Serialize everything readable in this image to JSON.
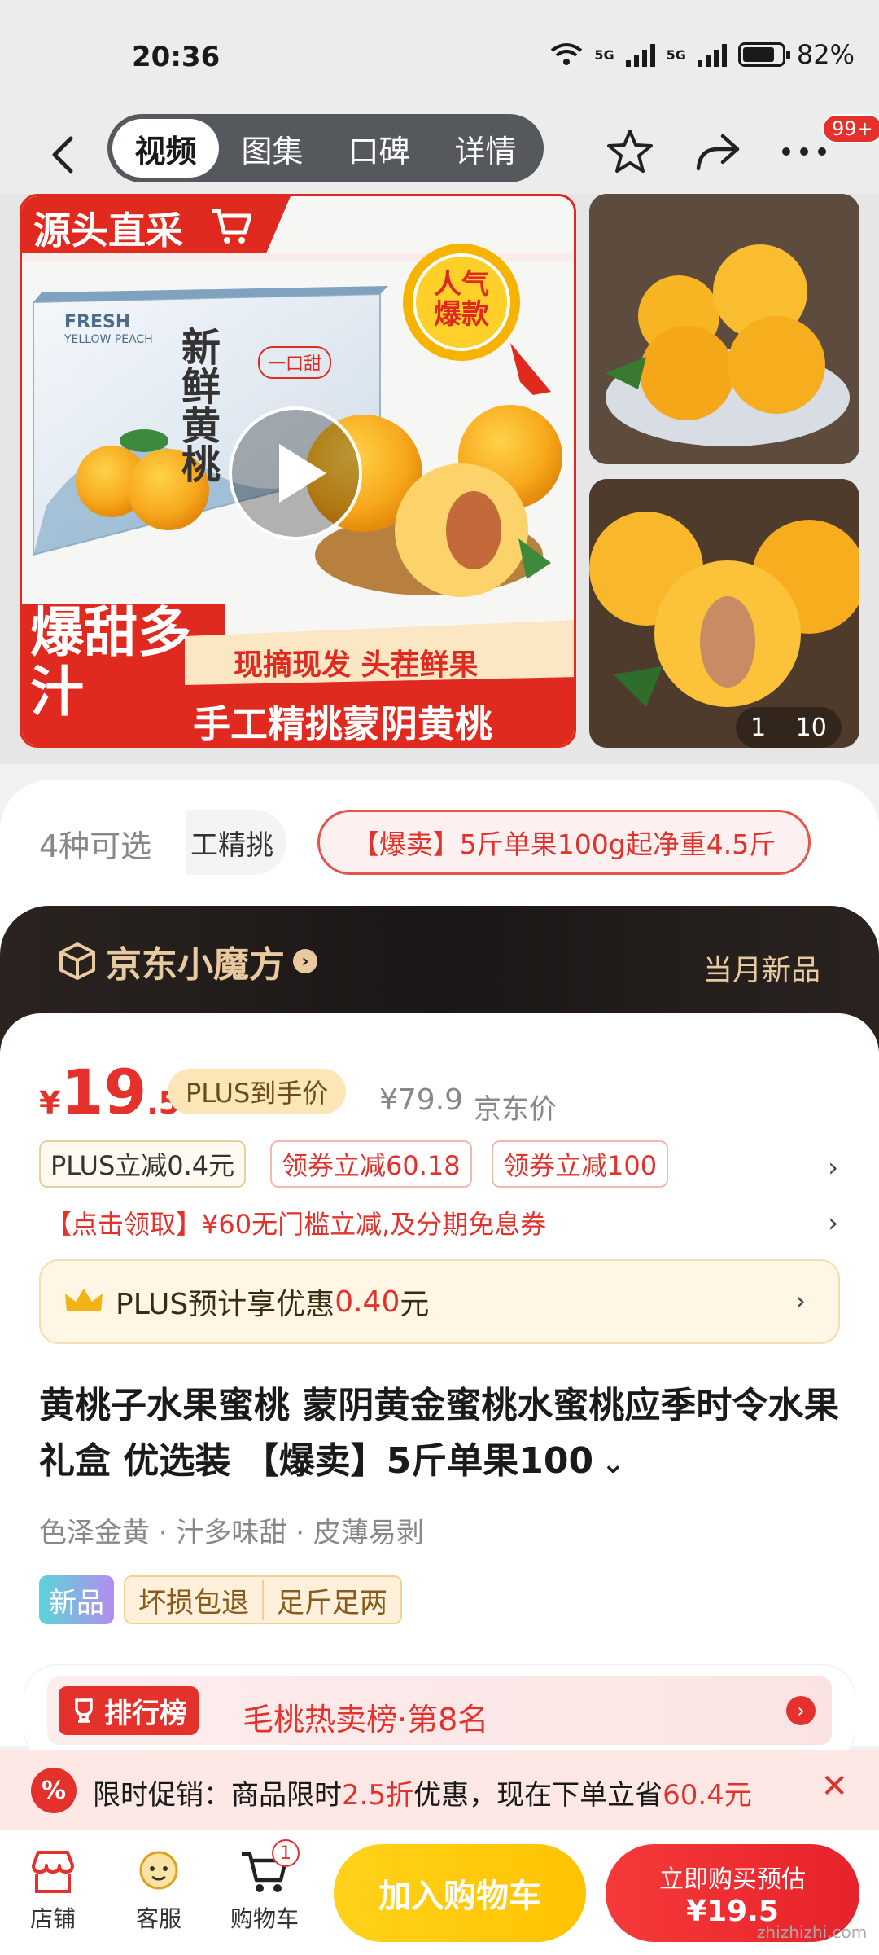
{
  "status": {
    "time": "20:36",
    "battery": "82%",
    "net1": "5G",
    "net2": "5G"
  },
  "nav": {
    "tabs": [
      "视频",
      "图集",
      "口碑",
      "详情"
    ],
    "active_tab": 0,
    "badge": "99+"
  },
  "gallery": {
    "main_banner_top": "源头直采",
    "box_fresh": "FRESH",
    "box_sub": "YELLOW PEACH",
    "box_cn": "新鲜黄桃",
    "box_tag": "一口甜",
    "badge_text": "人气爆款",
    "slogan_left": "爆甜多汁",
    "slogan_top": "现摘现发 头茬鲜果",
    "slogan_bottom": "手工精挑蒙阴黄桃",
    "counter_current": "1",
    "counter_total": "10"
  },
  "variants": {
    "count_label": "4种可选",
    "chip1": "工精挑",
    "chip2": "【爆卖】5斤单果100g起净重4.5斤"
  },
  "cube": {
    "title": "京东小魔方",
    "right_label": "当月新品"
  },
  "price": {
    "symbol": "¥",
    "integer": "19",
    "decimal": ".5",
    "plus_label": "PLUS到手价",
    "original": "¥79.9",
    "original_label": "京东价",
    "chips": [
      "PLUS立减0.4元",
      "领券立减60.18",
      "领券立减100"
    ],
    "coupon_line": "【点击领取】¥60无门槛立减,及分期免息券",
    "plus_bar_prefix": "PLUS预计享优惠",
    "plus_bar_value": "0.40",
    "plus_bar_suffix": "元"
  },
  "product": {
    "title": "黄桃子水果蜜桃 蒙阴黄金蜜桃水蜜桃应季时令水果礼盒 优选装 【爆卖】5斤单果100",
    "features": "色泽金黄 · 汁多味甜 · 皮薄易剥",
    "tag_new": "新品",
    "tag_guarantee_1": "坏损包退",
    "tag_guarantee_2": "足斤足两"
  },
  "ranking": {
    "tag": "排行榜",
    "text": "毛桃热卖榜·第8名"
  },
  "promo": {
    "icon": "%",
    "prefix": "限时促销：商品限时",
    "discount": "2.5折",
    "mid": "优惠，现在下单立省",
    "save": "60.4元"
  },
  "bottom": {
    "store": "店铺",
    "service": "客服",
    "cart": "购物车",
    "cart_count": "1",
    "add_cart": "加入购物车",
    "buy_line1": "立即购买预估",
    "buy_line2": "¥19.5"
  },
  "watermark": "zhizhizhi.com",
  "colors": {
    "accent": "#e4312b",
    "gold": "#ffc300",
    "cube_text": "#e8c9a0"
  }
}
